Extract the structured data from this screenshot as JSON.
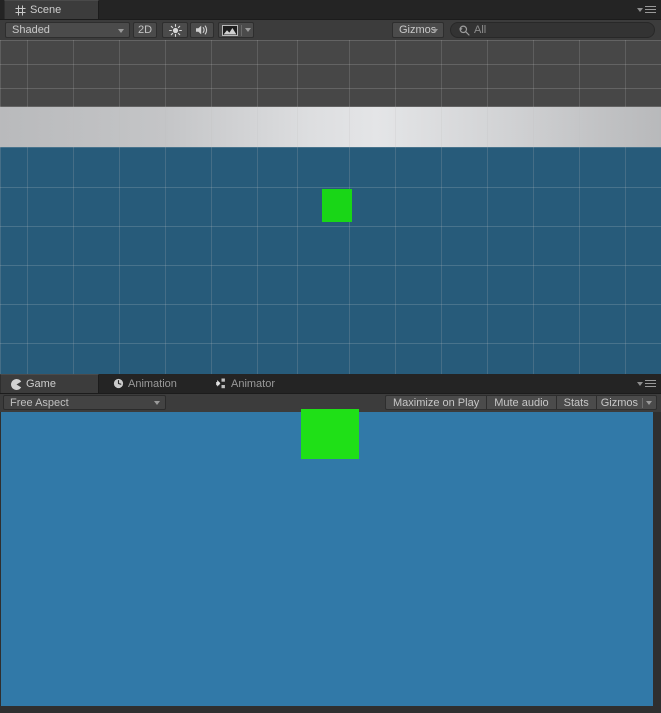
{
  "scene_panel": {
    "tabs": [
      {
        "label": "Scene",
        "icon": "grid-hash-icon",
        "active": true
      }
    ],
    "toolbar": {
      "draw_mode": "Shaded",
      "toggle_2d": "2D",
      "lighting_icon": "sun-icon",
      "audio_icon": "speaker-icon",
      "fx_icon": "image-effects-icon",
      "gizmos_label": "Gizmos",
      "search_placeholder": "All",
      "search_value": "All",
      "search_icon": "search-icon"
    },
    "window_menu_icon": "window-menu-icon",
    "view": {
      "sky_color": "#474747",
      "horizon_color": "#dddee0",
      "ground_color": "#275b7a",
      "grid_color": "#bebebe",
      "object_color": "#19d617",
      "object_name": "green-cube"
    }
  },
  "game_panel": {
    "tabs": [
      {
        "label": "Game",
        "icon": "game-pacman-icon",
        "active": true
      },
      {
        "label": "Animation",
        "icon": "clock-icon",
        "active": false
      },
      {
        "label": "Animator",
        "icon": "animator-nodes-icon",
        "active": false
      }
    ],
    "toolbar": {
      "aspect": "Free Aspect",
      "maximize_on_play": "Maximize on Play",
      "mute_audio": "Mute audio",
      "stats": "Stats",
      "gizmos": "Gizmos"
    },
    "window_menu_icon": "window-menu-icon",
    "view": {
      "background_color": "#3179a8",
      "object_color": "#1fe017",
      "object_name": "green-cube"
    }
  },
  "colors": {
    "panel_bg": "#393939",
    "tabstrip_bg": "#242424",
    "toolbar_bg": "#3c3c3c",
    "text": "#c2c2c2",
    "text_dim": "#9a9a9a"
  }
}
